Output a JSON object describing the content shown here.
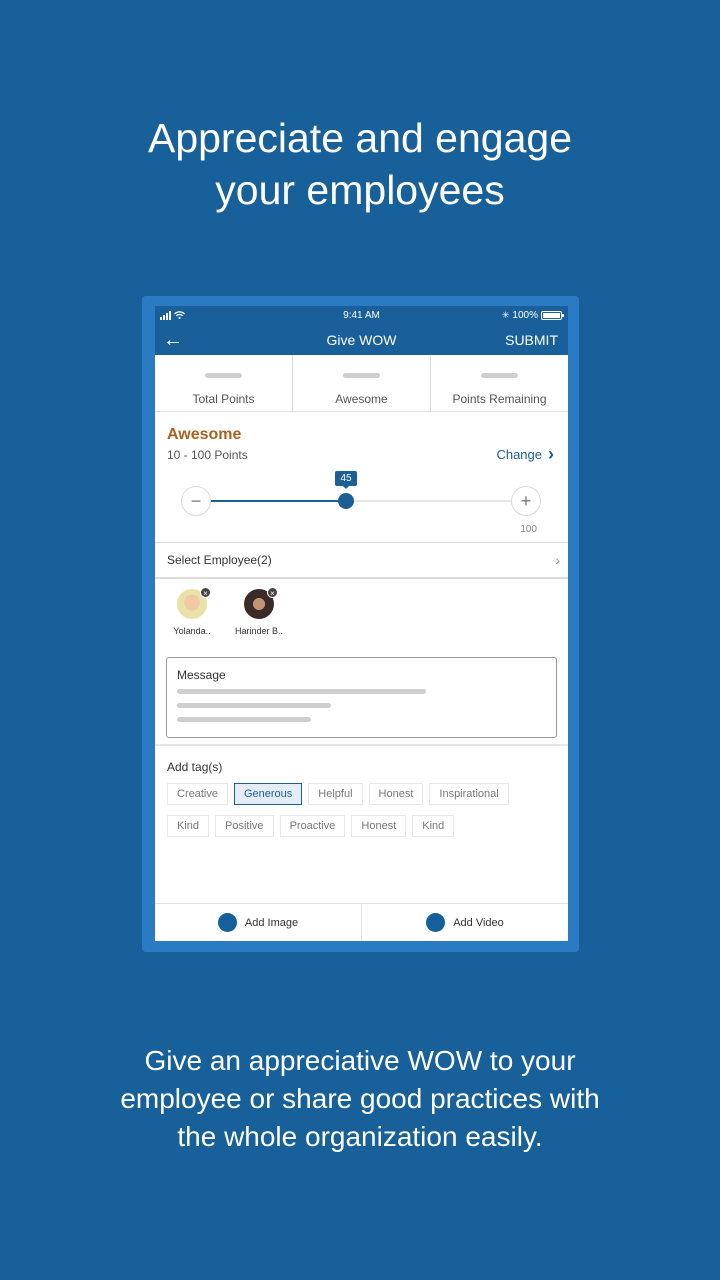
{
  "headline": {
    "line1": "Appreciate and engage",
    "line2": "your employees"
  },
  "footer": {
    "line1": "Give an appreciative WOW to your",
    "line2": "employee or share good practices with",
    "line3": "the whole organization easily."
  },
  "status_bar": {
    "time": "9:41 AM",
    "battery": "100%",
    "bluetooth_icon": "✳"
  },
  "navbar": {
    "back_icon": "←",
    "title": "Give WOW",
    "submit_label": "SUBMIT"
  },
  "stats": [
    {
      "label": "Total Points"
    },
    {
      "label": "Awesome"
    },
    {
      "label": "Points Remaining"
    }
  ],
  "award": {
    "name": "Awesome",
    "range": "10 - 100 Points",
    "change_label": "Change",
    "change_icon": "›",
    "slider": {
      "min": 10,
      "max": 100,
      "value": 45,
      "value_label": "45",
      "max_label": "100",
      "minus_icon": "−",
      "plus_icon": "+"
    }
  },
  "select_employee": {
    "label": "Select Employee(2)",
    "chevron_icon": "›"
  },
  "employees": [
    {
      "name": "Yolanda.."
    },
    {
      "name": "Harinder B.."
    }
  ],
  "message": {
    "label": "Message"
  },
  "tags": {
    "title": "Add tag(s)",
    "items": [
      {
        "label": "Creative",
        "selected": false
      },
      {
        "label": "Generous",
        "selected": true
      },
      {
        "label": "Helpful",
        "selected": false
      },
      {
        "label": "Honest",
        "selected": false
      },
      {
        "label": "Inspirational",
        "selected": false
      },
      {
        "label": "Kind",
        "selected": false
      },
      {
        "label": "Positive",
        "selected": false
      },
      {
        "label": "Proactive",
        "selected": false
      },
      {
        "label": "Honest",
        "selected": false
      },
      {
        "label": "Kind",
        "selected": false
      }
    ]
  },
  "actions": {
    "add_image": "Add Image",
    "add_video": "Add Video"
  },
  "colors": {
    "background": "#18609a",
    "primary": "#1c5f94",
    "award_name": "#a8641e"
  }
}
